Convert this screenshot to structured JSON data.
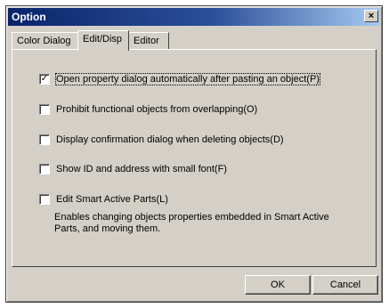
{
  "window": {
    "title": "Option",
    "close_glyph": "×"
  },
  "tabs": [
    {
      "label": "Color Dialog",
      "active": false
    },
    {
      "label": "Edit/Disp",
      "active": true
    },
    {
      "label": "Editor",
      "active": false
    }
  ],
  "options": [
    {
      "label": "Open property dialog automatically after pasting an object(P)",
      "checked": true
    },
    {
      "label": "Prohibit functional objects from overlapping(O)",
      "checked": false
    },
    {
      "label": "Display confirmation dialog when deleting objects(D)",
      "checked": false
    },
    {
      "label": "Show ID and address with small font(F)",
      "checked": false
    },
    {
      "label": "Edit Smart Active Parts(L)",
      "checked": false
    }
  ],
  "description": "Enables changing objects properties embedded in Smart Active Parts, and moving them.",
  "buttons": {
    "ok": "OK",
    "cancel": "Cancel"
  },
  "colors": {
    "titlebar_start": "#0a246a",
    "titlebar_end": "#a6caf0",
    "face": "#d4d0c8"
  }
}
